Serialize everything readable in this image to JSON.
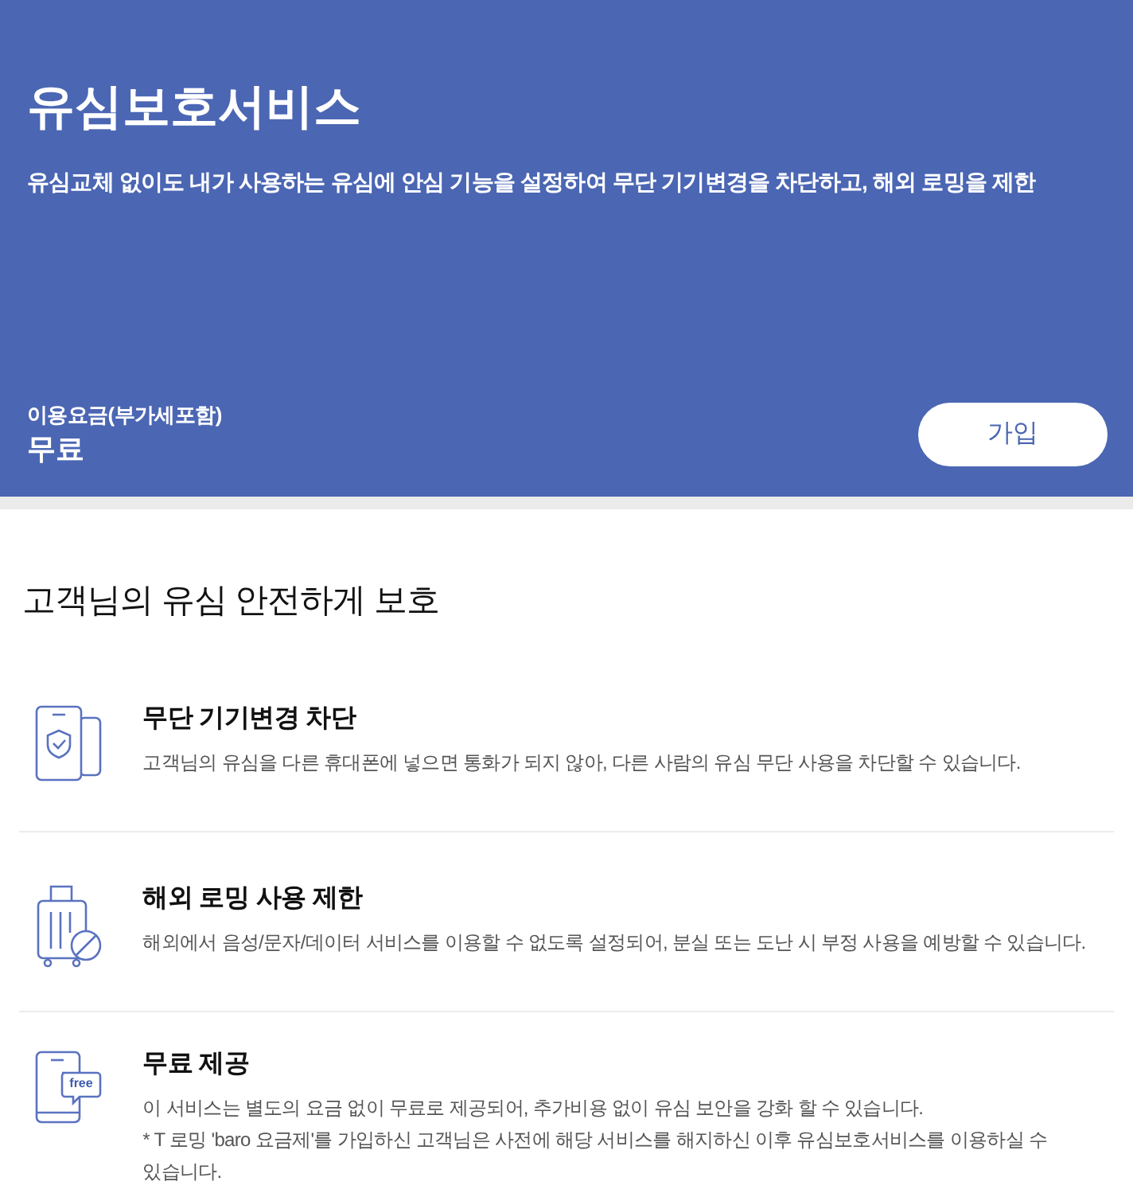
{
  "header": {
    "title": "유심보호서비스",
    "description": "유심교체 없이도 내가 사용하는 유심에 안심 기능을 설정하여 무단 기기변경을 차단하고, 해외 로밍을 제한",
    "fee_label": "이용요금(부가세포함)",
    "fee_value": "무료",
    "join_button": "가입"
  },
  "section": {
    "heading": "고객님의 유심 안전하게 보호",
    "features": [
      {
        "kind": "shield-phone",
        "title": "무단 기기변경 차단",
        "lines": [
          "고객님의 유심을 다른 휴대폰에 넣으면 통화가 되지 않아, 다른 사람의 유심 무단 사용을 차단할 수 있습니다."
        ]
      },
      {
        "kind": "luggage-blocked",
        "title": "해외 로밍 사용 제한",
        "lines": [
          "해외에서 음성/문자/데이터 서비스를 이용할 수 없도록 설정되어, 분실 또는 도난 시 부정 사용을 예방할 수 있습니다."
        ]
      },
      {
        "kind": "free-phone",
        "badge": "free",
        "title": "무료 제공",
        "lines": [
          "이 서비스는 별도의 요금 없이 무료로 제공되어, 추가비용 없이 유심 보안을 강화 할 수 있습니다.",
          "* T 로밍 'baro 요금제'를 가입하신 고객님은 사전에 해당 서비스를 해지하신 이후 유심보호서비스를 이용하실 수 있습니다."
        ]
      }
    ]
  }
}
